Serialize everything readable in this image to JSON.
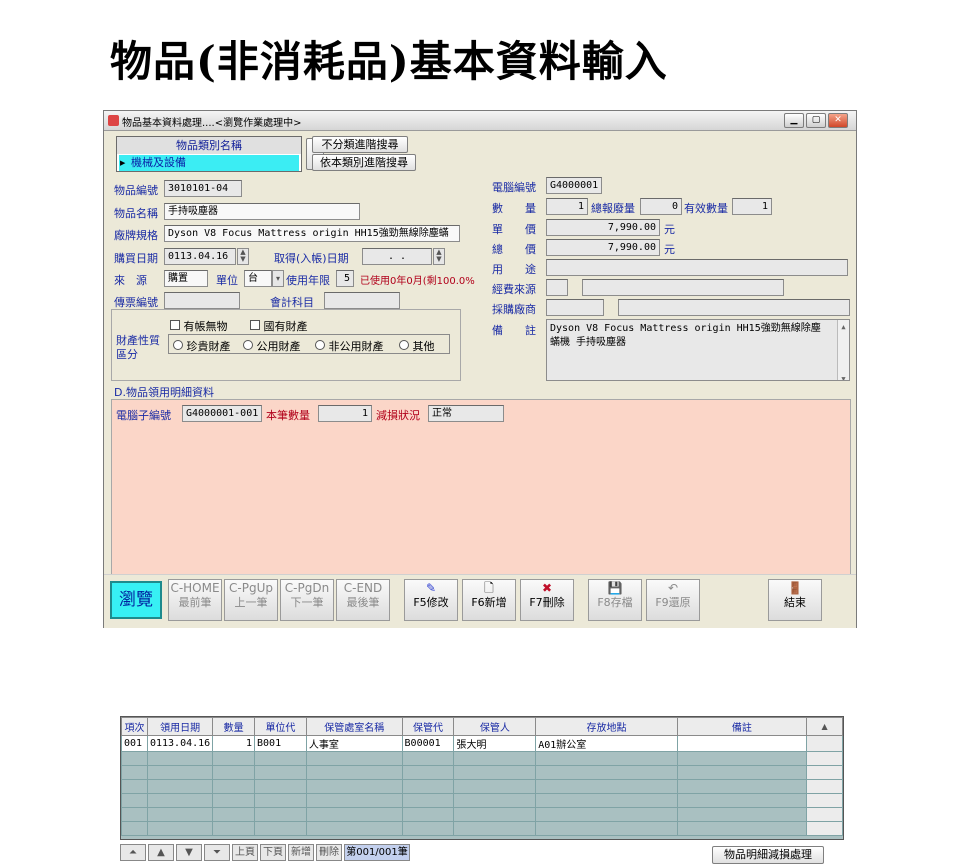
{
  "slide_title": "物品(非消耗品)基本資料輸入",
  "window": {
    "title": "物品基本資料處理....<瀏覽作業處理中>",
    "controls": [
      "minimize-icon",
      "maximize-icon",
      "close-icon"
    ]
  },
  "category": {
    "header": "物品類別名稱",
    "value": "機械及設備",
    "btn_no_category_search": "不分類進階搜尋",
    "btn_category_search": "依本類別進階搜尋"
  },
  "left_form": {
    "item_no_label": "物品編號",
    "item_no": "3010101-04",
    "item_name_label": "物品名稱",
    "item_name": "手持吸塵器",
    "brand_label": "廠牌規格",
    "brand": "Dyson V8 Focus Mattress origin HH15強勁無線除塵蟎",
    "purchase_date_label": "購買日期",
    "purchase_date": "0113.04.16",
    "acquire_date_label": "取得(入帳)日期",
    "acquire_date": ". .",
    "source_label": "來　源",
    "source": "購置",
    "unit_label": "單位",
    "unit": "台",
    "life_label": "使用年限",
    "life": "5",
    "used_note": "已使用0年0月(剩100.0%",
    "voucher_label": "傳票編號",
    "voucher": "",
    "account_label": "會計科目",
    "account": ""
  },
  "property": {
    "label_line1": "財產性質",
    "label_line2": "區分",
    "checks": [
      "有帳無物",
      "國有財產"
    ],
    "radios": [
      "珍貴財產",
      "公用財產",
      "非公用財產",
      "其他"
    ]
  },
  "right_form": {
    "pc_no_label": "電腦編號",
    "pc_no": "G4000001",
    "qty_label": "數　　量",
    "qty": "1",
    "loss_label": "總報廢量",
    "loss": "0",
    "valid_label": "有效數量",
    "valid": "1",
    "price_label": "單　　價",
    "price": "7,990.00",
    "total_label": "總　　價",
    "total": "7,990.00",
    "currency": "元",
    "use_label": "用　　途",
    "use": "",
    "fund_label": "經費來源",
    "fund": "",
    "vendor_label": "採購廠商",
    "vendor": "",
    "remark_label": "備　　註",
    "remark_line1": "Dyson V8 Focus Mattress origin HH15強勁無線除塵",
    "remark_line2": "蟎機 手持吸塵器"
  },
  "detail": {
    "section_title": "D.物品領用明細資料",
    "pc_sub_label": "電腦子編號",
    "pc_sub": "G4000001-001",
    "this_qty_label": "本筆數量",
    "this_qty": "1",
    "loss_status_label": "減損狀況",
    "loss_status": "正常",
    "columns": [
      "項次",
      "領用日期",
      "數量",
      "單位代",
      "保管處室名稱",
      "保管代",
      "保管人",
      "存放地點",
      "備註"
    ],
    "rows": [
      [
        "001",
        "0113.04.16",
        "1",
        "B001",
        "人事室",
        "B00001",
        "張大明",
        "A01辦公室",
        ""
      ]
    ],
    "nav": {
      "btn_prev_page": "上頁",
      "btn_next_page": "下頁",
      "btn_add": "新增",
      "btn_delete": "刪除",
      "record": "第001/001筆"
    },
    "btn_loss_process": "物品明細減損處理"
  },
  "toolbar": {
    "browse": "瀏覽",
    "home_key": "C-HOME",
    "home": "最前筆",
    "pgup_key": "C-PgUp",
    "pgup": "上一筆",
    "pgdn_key": "C-PgDn",
    "pgdn": "下一筆",
    "end_key": "C-END",
    "end": "最後筆",
    "f5": "F5修改",
    "f6": "F6新增",
    "f7": "F7刪除",
    "f8": "F8存檔",
    "f9": "F9還原",
    "exit": "結束"
  }
}
